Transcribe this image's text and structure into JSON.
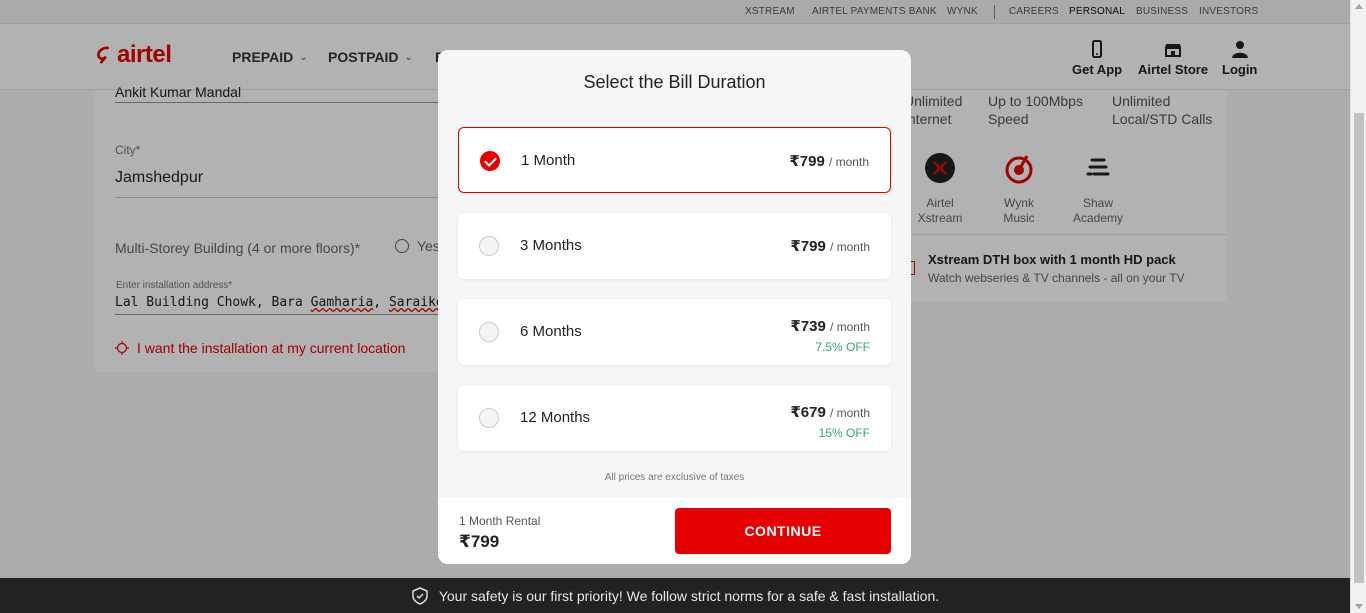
{
  "top_links": {
    "xstream": "XSTREAM",
    "payments_bank": "AIRTEL PAYMENTS BANK",
    "wynk": "WYNK",
    "careers": "CAREERS",
    "personal": "PERSONAL",
    "business": "BUSINESS",
    "investors": "INVESTORS"
  },
  "header": {
    "logo_text": "airtel",
    "nav": {
      "prepaid": "PREPAID",
      "postpaid": "POSTPAID",
      "third": "B"
    },
    "actions": {
      "get_app": "Get App",
      "store": "Airtel Store",
      "login": "Login"
    }
  },
  "form": {
    "name_value": "Ankit Kumar Mandal",
    "city_label": "City*",
    "city_value": "Jamshedpur",
    "multistorey_label": "Multi-Storey Building (4 or more floors)*",
    "yes_label": "Yes",
    "address_label": "Enter installation address*",
    "address_value_1": "Lal Building Chowk, Bara ",
    "address_value_2": "Gamharia",
    "address_value_3": ", ",
    "address_value_4": "Saraikela",
    "current_location": "I want the installation at my current location"
  },
  "plan": {
    "features": [
      {
        "line1": "Unlimited",
        "line2": "Internet"
      },
      {
        "line1": "Up to 100Mbps",
        "line2": "Speed"
      },
      {
        "line1": "Unlimited",
        "line2": "Local/STD Calls"
      }
    ],
    "benefits": [
      {
        "line1": "Airtel",
        "line2": "Xstream"
      },
      {
        "line1": "Wynk",
        "line2": "Music"
      },
      {
        "line1": "Shaw",
        "line2": "Academy"
      }
    ],
    "xstream_title": "Xstream DTH box with 1 month HD pack",
    "xstream_sub": "Watch webseries & TV channels - all on your TV"
  },
  "modal": {
    "title": "Select the Bill Duration",
    "options": [
      {
        "label": "1 Month",
        "price": "₹799",
        "per": "/ month",
        "off": "",
        "selected": true
      },
      {
        "label": "3 Months",
        "price": "₹799",
        "per": "/ month",
        "off": "",
        "selected": false
      },
      {
        "label": "6 Months",
        "price": "₹739",
        "per": "/ month",
        "off": "7.5% OFF",
        "selected": false
      },
      {
        "label": "12 Months",
        "price": "₹679",
        "per": "/ month",
        "off": "15% OFF",
        "selected": false
      }
    ],
    "note": "All prices are exclusive of taxes",
    "rental_label": "1 Month Rental",
    "rental_value": "₹799",
    "continue_label": "CONTINUE"
  },
  "bottom_bar": {
    "text": "Your safety is our first priority! We follow strict norms for a safe & fast installation."
  },
  "colors": {
    "brand": "#e40000",
    "discount": "#3aa76d"
  }
}
